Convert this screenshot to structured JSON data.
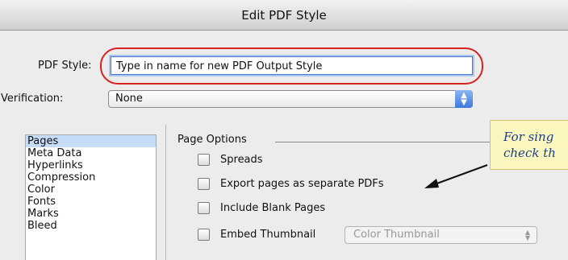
{
  "window": {
    "title": "Edit PDF Style"
  },
  "form": {
    "style_label": "PDF Style:",
    "style_value": "Type in name for new PDF Output Style",
    "verification_label": "Verification:",
    "verification_value": "None"
  },
  "sidebar": {
    "items": [
      {
        "label": "Pages",
        "selected": true
      },
      {
        "label": "Meta Data"
      },
      {
        "label": "Hyperlinks"
      },
      {
        "label": "Compression"
      },
      {
        "label": "Color"
      },
      {
        "label": "Fonts"
      },
      {
        "label": "Marks"
      },
      {
        "label": "Bleed"
      }
    ]
  },
  "page_options": {
    "title": "Page Options",
    "spreads_label": "Spreads",
    "export_separate_label": "Export pages as separate PDFs",
    "blank_pages_label": "Include Blank Pages",
    "embed_thumbnail_label": "Embed Thumbnail",
    "thumbnail_select_value": "Color Thumbnail"
  },
  "callout": {
    "line1": "For sing",
    "line2": "check th"
  },
  "colors": {
    "highlight_ring": "#d82121",
    "selection": "#c7dcf7",
    "callout_bg": "#fcf6bf",
    "callout_text": "#1a3f8a"
  }
}
